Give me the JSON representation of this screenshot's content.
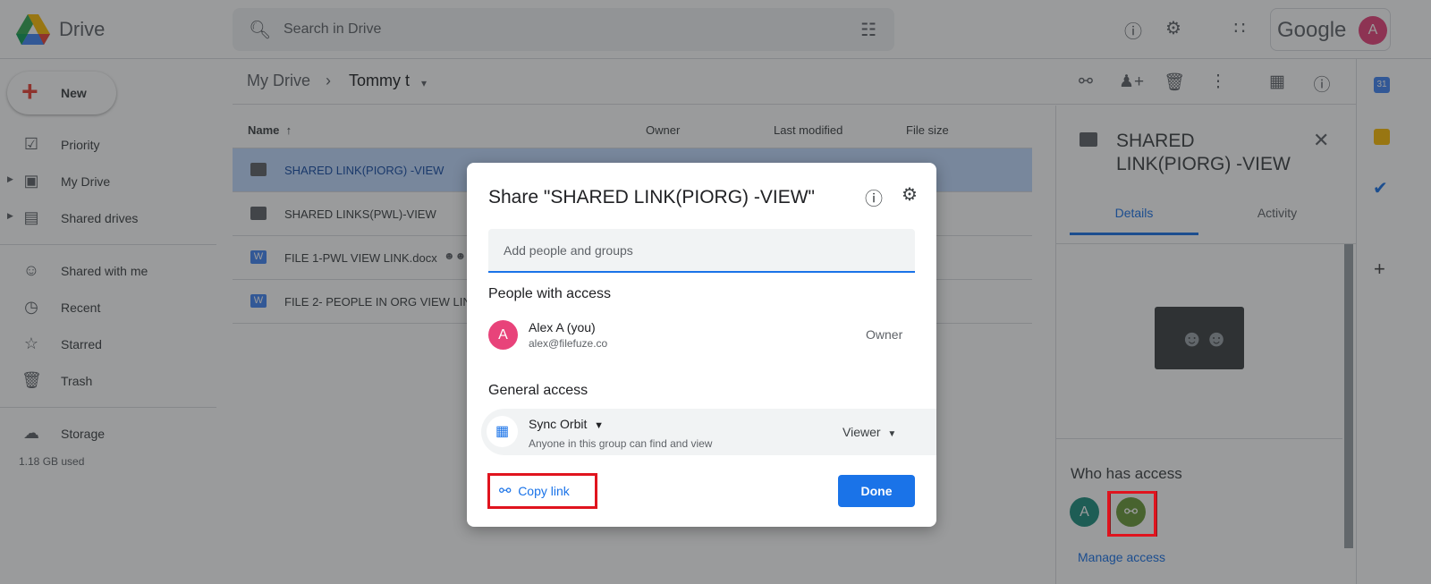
{
  "app": {
    "name": "Drive",
    "google_label": "Google",
    "avatar_initial": "A",
    "avatar_color": "#e8437a"
  },
  "search": {
    "placeholder": "Search in Drive"
  },
  "sidebar": {
    "new_label": "New",
    "items": [
      {
        "label": "Priority",
        "icon": "priority-check-icon"
      },
      {
        "label": "My Drive",
        "icon": "my-drive-icon"
      },
      {
        "label": "Shared drives",
        "icon": "shared-drives-icon"
      },
      {
        "label": "Shared with me",
        "icon": "people-icon"
      },
      {
        "label": "Recent",
        "icon": "clock-icon"
      },
      {
        "label": "Starred",
        "icon": "star-icon"
      },
      {
        "label": "Trash",
        "icon": "trash-icon"
      },
      {
        "label": "Storage",
        "icon": "cloud-icon"
      }
    ],
    "storage_used": "1.18 GB used"
  },
  "breadcrumb": {
    "root": "My Drive",
    "current": "Tommy t"
  },
  "list": {
    "columns": [
      "Name",
      "Owner",
      "Last modified",
      "File size"
    ],
    "rows": [
      {
        "name": "SHARED LINK(PIORG) -VIEW",
        "type": "shared-folder",
        "selected": true
      },
      {
        "name": "SHARED LINKS(PWL)-VIEW",
        "type": "shared-folder"
      },
      {
        "name": "FILE 1-PWL VIEW LINK.docx",
        "type": "word",
        "shared": true
      },
      {
        "name": "FILE 2- PEOPLE IN ORG VIEW LINK",
        "type": "word"
      }
    ]
  },
  "details": {
    "title": "SHARED LINK(PIORG) -VIEW",
    "tabs": [
      "Details",
      "Activity"
    ],
    "active_tab": "Details",
    "who_has_access": "Who has access",
    "owner_initial": "A",
    "owner_color": "#1e8e7e",
    "link_color": "#6a9a3a",
    "manage_access": "Manage access"
  },
  "dialog": {
    "title": "Share \"SHARED LINK(PIORG) -VIEW\"",
    "input_placeholder": "Add people and groups",
    "people_heading": "People with access",
    "person": {
      "initial": "A",
      "name": "Alex A (you)",
      "email": "alex@filefuze.co",
      "role": "Owner"
    },
    "general_heading": "General access",
    "general": {
      "group": "Sync Orbit",
      "description": "Anyone in this group can find and view",
      "role": "Viewer"
    },
    "copy_link": "Copy link",
    "done": "Done"
  },
  "colors": {
    "accent": "#1a73e8",
    "highlight": "#e0141e"
  }
}
